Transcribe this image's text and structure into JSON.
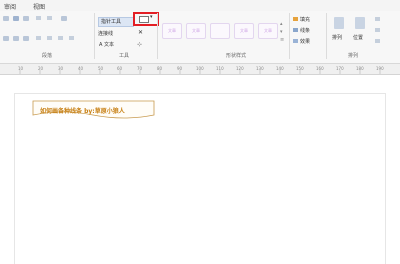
{
  "tabs": {
    "review": "审阅",
    "view": "视图"
  },
  "groups": {
    "paragraph": "段落",
    "tools": "工具",
    "shape_styles": "形状样式",
    "arrange": "排列"
  },
  "tools": {
    "pointer": "指针工具",
    "connector": "连接线",
    "text": "A 文本"
  },
  "shape_styles": {
    "thumb_label": "文章"
  },
  "right": {
    "fill": "填充",
    "line": "线条",
    "effect": "效果",
    "arrange": "排列",
    "position": "位置"
  },
  "ruler_numbers": [
    "10",
    "20",
    "30",
    "40",
    "50",
    "60",
    "70",
    "80",
    "90",
    "100",
    "110",
    "120",
    "130",
    "140",
    "150",
    "160",
    "170",
    "180",
    "190",
    "200"
  ],
  "canvas": {
    "title": "如何画各种线条   by:草原小狼人"
  },
  "colors": {
    "highlight": "#e31e24",
    "title_text": "#c77f12",
    "title_border": "#c89a4e"
  }
}
